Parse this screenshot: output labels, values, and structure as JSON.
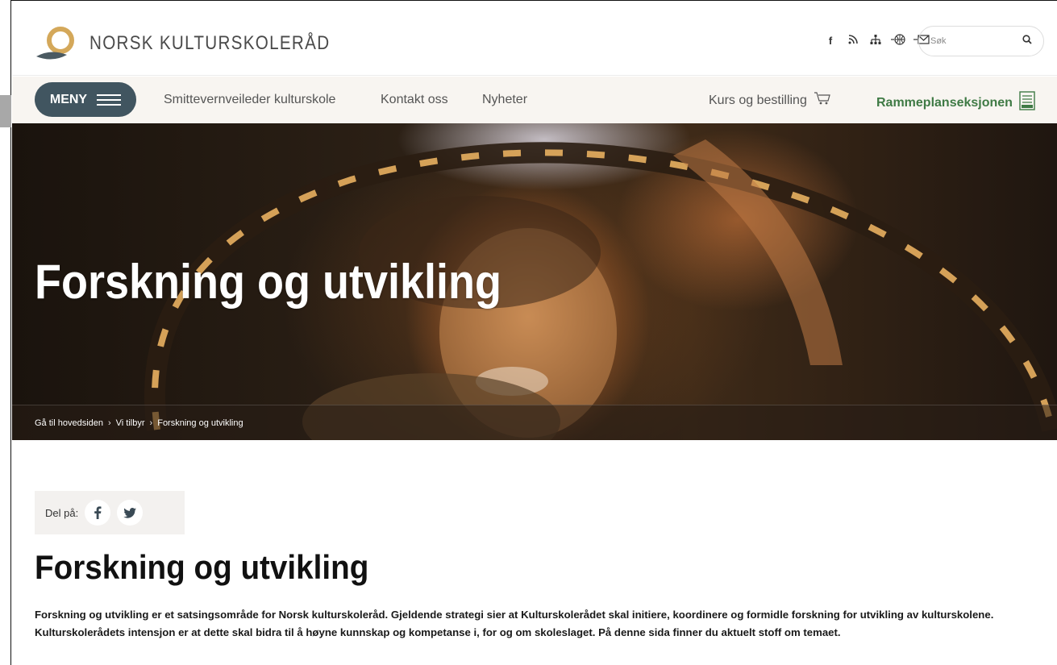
{
  "header": {
    "logo_text": "NORSK KULTURSKOLERÅD",
    "social_icons": [
      "facebook-icon",
      "rss-icon",
      "sitemap-icon",
      "language-icon",
      "mail-icon"
    ],
    "search": {
      "placeholder": "Søk"
    }
  },
  "nav": {
    "menu_label": "MENY",
    "links": [
      "Smittevernveileder kulturskole",
      "Kontakt oss",
      "Nyheter"
    ],
    "shop_label": "Kurs og bestilling",
    "framework_label": "Rammeplanseksjonen"
  },
  "hero": {
    "title": "Forskning og utvikling",
    "breadcrumb": [
      "Gå til hovedsiden",
      "Vi tilbyr",
      "Forskning og utvikling"
    ]
  },
  "content": {
    "share_label": "Del på:",
    "title": "Forskning og utvikling",
    "intro": "Forskning og utvikling er et satsingsområde for Norsk kulturskoleråd. Gjeldende strategi sier at Kulturskolerådet skal initiere, koordinere og formidle forskning for utvikling av kulturskolene. Kulturskolerådets intensjon er at dette skal bidra til å høyne kunnskap og kompetanse i, for og om skoleslaget. På denne sida finner du aktuelt stoff om temaet."
  },
  "colors": {
    "menu_button": "#415560",
    "framework_green": "#3f7a45",
    "logo_gold": "#d4a85a"
  }
}
